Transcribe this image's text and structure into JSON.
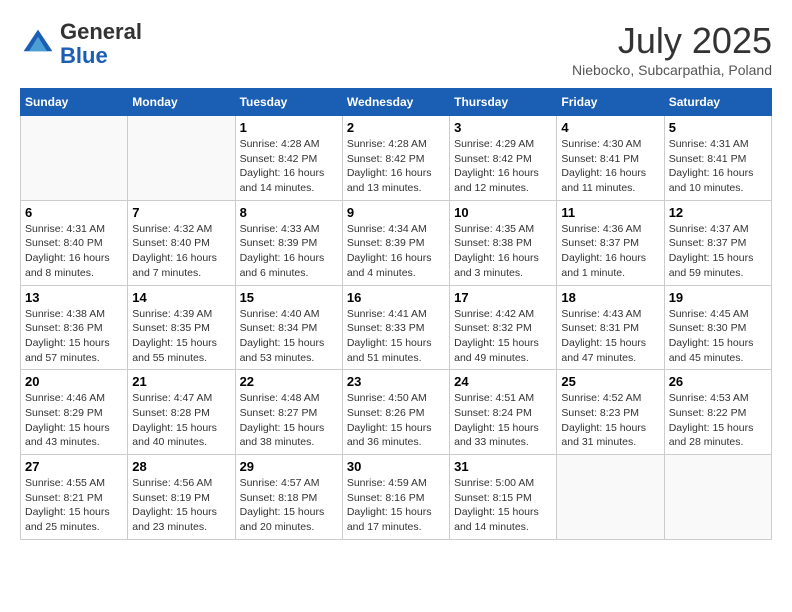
{
  "header": {
    "logo_general": "General",
    "logo_blue": "Blue",
    "month_title": "July 2025",
    "location": "Niebocko, Subcarpathia, Poland"
  },
  "weekdays": [
    "Sunday",
    "Monday",
    "Tuesday",
    "Wednesday",
    "Thursday",
    "Friday",
    "Saturday"
  ],
  "weeks": [
    [
      {
        "day": "",
        "sunrise": "",
        "sunset": "",
        "daylight": ""
      },
      {
        "day": "",
        "sunrise": "",
        "sunset": "",
        "daylight": ""
      },
      {
        "day": "1",
        "sunrise": "Sunrise: 4:28 AM",
        "sunset": "Sunset: 8:42 PM",
        "daylight": "Daylight: 16 hours and 14 minutes."
      },
      {
        "day": "2",
        "sunrise": "Sunrise: 4:28 AM",
        "sunset": "Sunset: 8:42 PM",
        "daylight": "Daylight: 16 hours and 13 minutes."
      },
      {
        "day": "3",
        "sunrise": "Sunrise: 4:29 AM",
        "sunset": "Sunset: 8:42 PM",
        "daylight": "Daylight: 16 hours and 12 minutes."
      },
      {
        "day": "4",
        "sunrise": "Sunrise: 4:30 AM",
        "sunset": "Sunset: 8:41 PM",
        "daylight": "Daylight: 16 hours and 11 minutes."
      },
      {
        "day": "5",
        "sunrise": "Sunrise: 4:31 AM",
        "sunset": "Sunset: 8:41 PM",
        "daylight": "Daylight: 16 hours and 10 minutes."
      }
    ],
    [
      {
        "day": "6",
        "sunrise": "Sunrise: 4:31 AM",
        "sunset": "Sunset: 8:40 PM",
        "daylight": "Daylight: 16 hours and 8 minutes."
      },
      {
        "day": "7",
        "sunrise": "Sunrise: 4:32 AM",
        "sunset": "Sunset: 8:40 PM",
        "daylight": "Daylight: 16 hours and 7 minutes."
      },
      {
        "day": "8",
        "sunrise": "Sunrise: 4:33 AM",
        "sunset": "Sunset: 8:39 PM",
        "daylight": "Daylight: 16 hours and 6 minutes."
      },
      {
        "day": "9",
        "sunrise": "Sunrise: 4:34 AM",
        "sunset": "Sunset: 8:39 PM",
        "daylight": "Daylight: 16 hours and 4 minutes."
      },
      {
        "day": "10",
        "sunrise": "Sunrise: 4:35 AM",
        "sunset": "Sunset: 8:38 PM",
        "daylight": "Daylight: 16 hours and 3 minutes."
      },
      {
        "day": "11",
        "sunrise": "Sunrise: 4:36 AM",
        "sunset": "Sunset: 8:37 PM",
        "daylight": "Daylight: 16 hours and 1 minute."
      },
      {
        "day": "12",
        "sunrise": "Sunrise: 4:37 AM",
        "sunset": "Sunset: 8:37 PM",
        "daylight": "Daylight: 15 hours and 59 minutes."
      }
    ],
    [
      {
        "day": "13",
        "sunrise": "Sunrise: 4:38 AM",
        "sunset": "Sunset: 8:36 PM",
        "daylight": "Daylight: 15 hours and 57 minutes."
      },
      {
        "day": "14",
        "sunrise": "Sunrise: 4:39 AM",
        "sunset": "Sunset: 8:35 PM",
        "daylight": "Daylight: 15 hours and 55 minutes."
      },
      {
        "day": "15",
        "sunrise": "Sunrise: 4:40 AM",
        "sunset": "Sunset: 8:34 PM",
        "daylight": "Daylight: 15 hours and 53 minutes."
      },
      {
        "day": "16",
        "sunrise": "Sunrise: 4:41 AM",
        "sunset": "Sunset: 8:33 PM",
        "daylight": "Daylight: 15 hours and 51 minutes."
      },
      {
        "day": "17",
        "sunrise": "Sunrise: 4:42 AM",
        "sunset": "Sunset: 8:32 PM",
        "daylight": "Daylight: 15 hours and 49 minutes."
      },
      {
        "day": "18",
        "sunrise": "Sunrise: 4:43 AM",
        "sunset": "Sunset: 8:31 PM",
        "daylight": "Daylight: 15 hours and 47 minutes."
      },
      {
        "day": "19",
        "sunrise": "Sunrise: 4:45 AM",
        "sunset": "Sunset: 8:30 PM",
        "daylight": "Daylight: 15 hours and 45 minutes."
      }
    ],
    [
      {
        "day": "20",
        "sunrise": "Sunrise: 4:46 AM",
        "sunset": "Sunset: 8:29 PM",
        "daylight": "Daylight: 15 hours and 43 minutes."
      },
      {
        "day": "21",
        "sunrise": "Sunrise: 4:47 AM",
        "sunset": "Sunset: 8:28 PM",
        "daylight": "Daylight: 15 hours and 40 minutes."
      },
      {
        "day": "22",
        "sunrise": "Sunrise: 4:48 AM",
        "sunset": "Sunset: 8:27 PM",
        "daylight": "Daylight: 15 hours and 38 minutes."
      },
      {
        "day": "23",
        "sunrise": "Sunrise: 4:50 AM",
        "sunset": "Sunset: 8:26 PM",
        "daylight": "Daylight: 15 hours and 36 minutes."
      },
      {
        "day": "24",
        "sunrise": "Sunrise: 4:51 AM",
        "sunset": "Sunset: 8:24 PM",
        "daylight": "Daylight: 15 hours and 33 minutes."
      },
      {
        "day": "25",
        "sunrise": "Sunrise: 4:52 AM",
        "sunset": "Sunset: 8:23 PM",
        "daylight": "Daylight: 15 hours and 31 minutes."
      },
      {
        "day": "26",
        "sunrise": "Sunrise: 4:53 AM",
        "sunset": "Sunset: 8:22 PM",
        "daylight": "Daylight: 15 hours and 28 minutes."
      }
    ],
    [
      {
        "day": "27",
        "sunrise": "Sunrise: 4:55 AM",
        "sunset": "Sunset: 8:21 PM",
        "daylight": "Daylight: 15 hours and 25 minutes."
      },
      {
        "day": "28",
        "sunrise": "Sunrise: 4:56 AM",
        "sunset": "Sunset: 8:19 PM",
        "daylight": "Daylight: 15 hours and 23 minutes."
      },
      {
        "day": "29",
        "sunrise": "Sunrise: 4:57 AM",
        "sunset": "Sunset: 8:18 PM",
        "daylight": "Daylight: 15 hours and 20 minutes."
      },
      {
        "day": "30",
        "sunrise": "Sunrise: 4:59 AM",
        "sunset": "Sunset: 8:16 PM",
        "daylight": "Daylight: 15 hours and 17 minutes."
      },
      {
        "day": "31",
        "sunrise": "Sunrise: 5:00 AM",
        "sunset": "Sunset: 8:15 PM",
        "daylight": "Daylight: 15 hours and 14 minutes."
      },
      {
        "day": "",
        "sunrise": "",
        "sunset": "",
        "daylight": ""
      },
      {
        "day": "",
        "sunrise": "",
        "sunset": "",
        "daylight": ""
      }
    ]
  ]
}
